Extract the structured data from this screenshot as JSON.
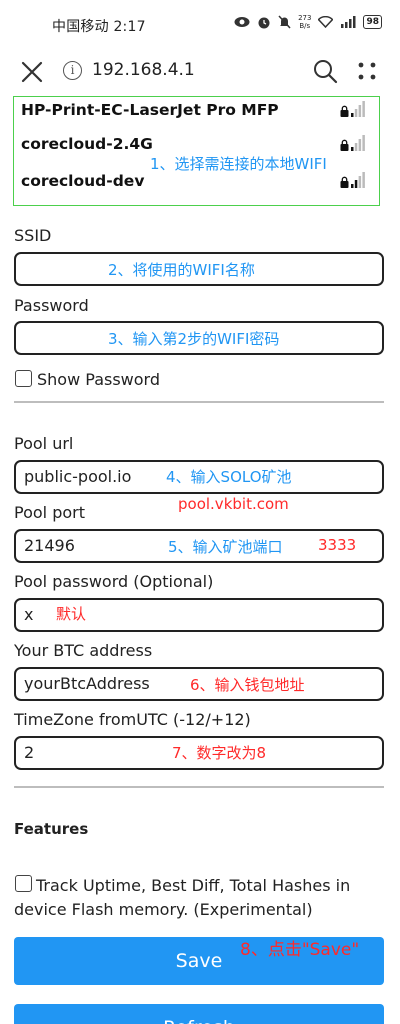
{
  "status_bar": {
    "carrier_time": "中国移动 2:17",
    "speed_value": "273",
    "speed_unit": "B/s",
    "battery": "98"
  },
  "url_bar": {
    "url": "192.168.4.1"
  },
  "wifi_list": [
    {
      "ssid": "HP-Print-EC-LaserJet Pro MFP"
    },
    {
      "ssid": "corecloud-2.4G"
    },
    {
      "ssid": "corecloud-dev"
    }
  ],
  "annotations": {
    "step1": "1、选择需连接的本地WIFI",
    "step2": "2、将使用的WIFI名称",
    "step3": "3、输入第2步的WIFI密码",
    "step4": "4、输入SOLO矿池",
    "pool_hint": "pool.vkbit.com",
    "step5": "5、输入矿池端口",
    "port_hint": "3333",
    "default_hint": "默认",
    "step6": "6、输入钱包地址",
    "step7": "7、数字改为8",
    "step8": "8、点击\"Save\""
  },
  "form": {
    "ssid_label": "SSID",
    "ssid_value": "",
    "password_label": "Password",
    "password_value": "",
    "show_password_label": "Show Password",
    "pool_url_label": "Pool url",
    "pool_url_value": "public-pool.io",
    "pool_port_label": "Pool port",
    "pool_port_value": "21496",
    "pool_password_label": "Pool password (Optional)",
    "pool_password_value": "x",
    "btc_label": "Your BTC address",
    "btc_value": "yourBtcAddress",
    "timezone_label": "TimeZone fromUTC (-12/+12)",
    "timezone_value": "2",
    "features_heading": "Features",
    "track_label": "Track Uptime, Best Diff, Total Hashes in device Flash memory. (Experimental)",
    "save_label": "Save",
    "refresh_label": "Refresh"
  },
  "colors": {
    "accent": "#2196f3",
    "annotation_blue": "#2196f3",
    "annotation_red": "#ff2a2a",
    "wifi_box_border": "#4cd04c"
  },
  "icons": {
    "close": "close-icon",
    "info": "info-icon",
    "search": "search-icon",
    "more": "more-dots-icon",
    "lock": "lock-icon",
    "signal": "wifi-signal-icon"
  }
}
